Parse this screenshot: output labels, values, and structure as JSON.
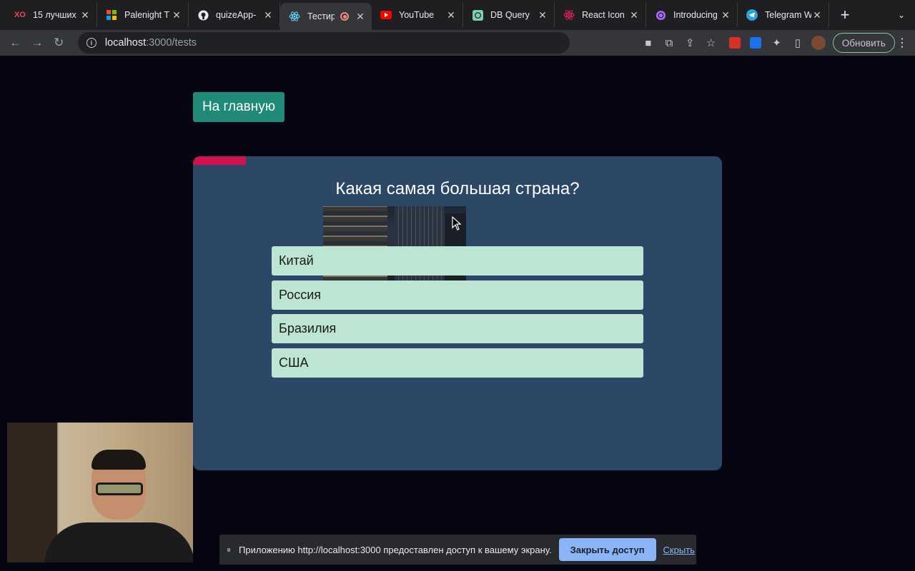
{
  "browser": {
    "tabs": [
      {
        "title": "15 лучших",
        "icon": "xo-icon",
        "active": false
      },
      {
        "title": "Palenight T",
        "icon": "microsoft-icon",
        "active": false
      },
      {
        "title": "quizeApp-",
        "icon": "github-icon",
        "active": false
      },
      {
        "title": "Тестир",
        "icon": "react-icon",
        "active": true
      },
      {
        "title": "YouTube",
        "icon": "youtube-icon",
        "active": false
      },
      {
        "title": "DB Query",
        "icon": "openai-icon",
        "active": false
      },
      {
        "title": "React Icon",
        "icon": "react-icons-icon",
        "active": false
      },
      {
        "title": "Introducing",
        "icon": "chatgpt-icon",
        "active": false
      },
      {
        "title": "Telegram W",
        "icon": "telegram-icon",
        "active": false
      }
    ],
    "url_host": "localhost",
    "url_path": ":3000/tests",
    "update_label": "Обновить"
  },
  "page": {
    "home_button": "На главную",
    "question": "Какая самая большая страна?",
    "progress": 0.1,
    "answers": [
      "Китай",
      "Россия",
      "Бразилия",
      "США"
    ]
  },
  "share_bar": {
    "message": "Приложению http://localhost:3000 предоставлен доступ к вашему экрану.",
    "stop_label": "Закрыть доступ",
    "hide_label": "Скрыть"
  },
  "colors": {
    "background": "#060613",
    "card": "#2d4766",
    "progress": "#d11150",
    "answer": "#bde5d3",
    "home_button": "#1f8a78"
  }
}
